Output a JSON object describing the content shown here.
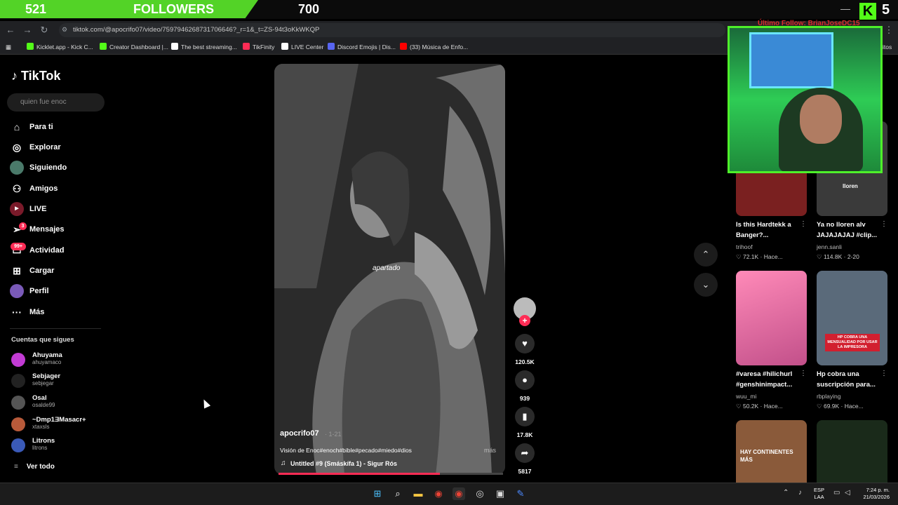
{
  "overlay": {
    "followers_count": "521",
    "followers_label": "FOLLOWERS",
    "followers_goal": "700",
    "followers_progress_fraction": 0.74,
    "kick_logo": "K",
    "kick_number": "5",
    "alert_text": "Último Follow: BrianJoseDC15",
    "bar_color": "#53d327"
  },
  "browser": {
    "url": "tiktok.com/@apocrifo07/video/7597946268731706646?_r=1&_t=ZS-94t3oKkWKQP",
    "bookmarks": [
      {
        "label": "Kicklet.app - Kick C...",
        "color": "#53fc18"
      },
      {
        "label": "Creator Dashboard |...",
        "color": "#53fc18"
      },
      {
        "label": "The best streaming...",
        "color": "#ffffff"
      },
      {
        "label": "TikFinity",
        "color": "#fe2c55"
      },
      {
        "label": "LIVE Center",
        "color": "#ffffff"
      },
      {
        "label": "Discord Emojis | Dis...",
        "color": "#5865f2"
      },
      {
        "label": "(33) Música de Enfo...",
        "color": "#ff0000"
      }
    ],
    "bookmark_overflow": "itos"
  },
  "sidebar": {
    "logo": "TikTok",
    "search_placeholder": "quien fue enoc",
    "nav": [
      {
        "label": "Para ti",
        "icon": "home-icon"
      },
      {
        "label": "Explorar",
        "icon": "compass-icon"
      },
      {
        "label": "Siguiendo",
        "icon": "following-avatar-icon"
      },
      {
        "label": "Amigos",
        "icon": "friends-icon"
      },
      {
        "label": "LIVE",
        "icon": "live-icon"
      },
      {
        "label": "Mensajes",
        "icon": "messages-icon",
        "badge": "3"
      },
      {
        "label": "Actividad",
        "icon": "activity-icon",
        "badge": "99+"
      },
      {
        "label": "Cargar",
        "icon": "upload-icon"
      },
      {
        "label": "Perfil",
        "icon": "profile-icon"
      },
      {
        "label": "Más",
        "icon": "more-icon"
      }
    ],
    "following_header": "Cuentas que sigues",
    "accounts": [
      {
        "name": "Ahuyama",
        "handle": "ahuyamaco",
        "color": "#c23bd4"
      },
      {
        "name": "Sebjager",
        "handle": "sebjegar",
        "color": "#222222"
      },
      {
        "name": "Osal",
        "handle": "osalde99",
        "color": "#555555"
      },
      {
        "name": "~Dmp1ƎMasacr+",
        "handle": "xtaxsls",
        "color": "#b85a3a"
      },
      {
        "name": "Litrons",
        "handle": "litrons",
        "color": "#3a5ab8"
      }
    ],
    "see_all": "Ver todo"
  },
  "video": {
    "author": "apocrifo07",
    "date": "· 1-21",
    "caption_text": "apartado",
    "description": "Visión de Enoc#enoch#bible#pecado#miedo#dios",
    "more": "más",
    "music": "Untitled #9 (Smáskífa 1) - Sigur Rós",
    "progress_fraction": 0.72,
    "likes": "120.5K",
    "comments": "939",
    "saves": "17.8K",
    "shares": "5817"
  },
  "recommendations": [
    {
      "title": "Is this Hardtekk a Banger?...",
      "author": "trihoof",
      "views": "♡ 72.1K · Hace...",
      "bg": "#7a2020",
      "overlay": ""
    },
    {
      "title": "Ya no lloren alv JAJAJAJAJ #clip...",
      "author": "jenn.sanli",
      "views": "♡ 114.8K · 2-20",
      "bg": "#3a3a3a",
      "overlay": "lloren"
    },
    {
      "title": "#varesa #hilichurl #genshinimpact...",
      "author": "wuu_mi",
      "views": "♡ 50.2K · Hace...",
      "bg": "#e86a9a",
      "overlay": ""
    },
    {
      "title": "Hp cobra una suscripción para...",
      "author": "rbplaying",
      "views": "♡ 69.9K · Hace...",
      "bg": "#5a6a7a",
      "overlay": "HP COBRA UNA MENSUALIDAD POR USAR LA IMPRESORA"
    },
    {
      "title": "",
      "author": "",
      "views": "",
      "bg": "#8a5a3a",
      "overlay": "HAY CONTINENTES MÁS"
    },
    {
      "title": "",
      "author": "",
      "views": "",
      "bg": "#1a2a1a",
      "overlay": ""
    }
  ],
  "taskbar": {
    "lang_line1": "ESP",
    "lang_line2": "LAA",
    "time": "7:24 p. m.",
    "date": "21/03/2026"
  }
}
